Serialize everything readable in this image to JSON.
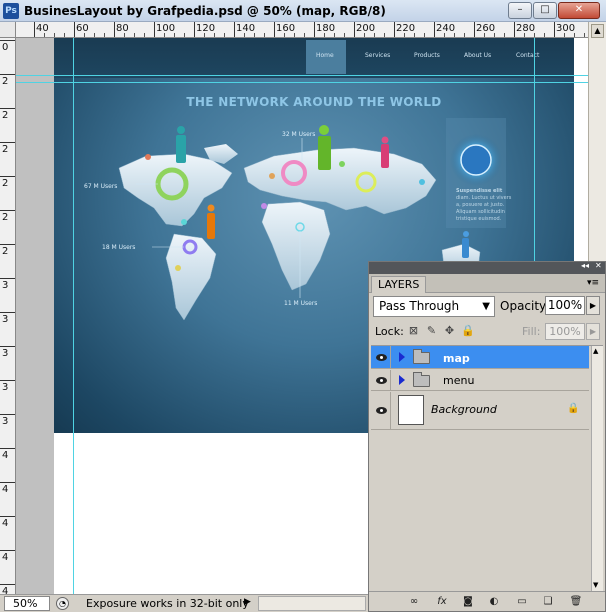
{
  "window": {
    "title": "BusinesLayout by Grafpedia.psd @ 50% (map, RGB/8)",
    "app_badge": "Ps",
    "minimize_glyph": "–",
    "maximize_glyph": "□",
    "close_glyph": "✕"
  },
  "rulers": {
    "horizontal_labels": [
      "40",
      "60",
      "80",
      "100",
      "120",
      "140",
      "160",
      "180",
      "200",
      "220",
      "240",
      "260",
      "280",
      "300"
    ],
    "vertical_labels": [
      "0",
      "2",
      "2",
      "2",
      "2",
      "2",
      "2",
      "3",
      "3",
      "3",
      "3",
      "3",
      "4",
      "4",
      "4",
      "4",
      "4"
    ]
  },
  "artwork": {
    "nav_items": [
      "Home",
      "Services",
      "Products",
      "About Us",
      "Contact"
    ],
    "headline": "THE NETWORK AROUND THE WORLD",
    "map_labels": [
      "32 M Users",
      "67 M Users",
      "18 M Users",
      "11 M Users"
    ],
    "side_text": [
      "Suspendisse elit",
      "diam. Luctus ut vivers",
      "a, posuere at justo.",
      "Aliquam sollicitudin",
      "tristique euismod."
    ]
  },
  "statusbar": {
    "zoom": "50%",
    "info_glyph": "◔",
    "status_text": "Exposure works in 32-bit only",
    "arrow": "▶"
  },
  "layers_panel": {
    "tab_label": "LAYERS",
    "collapse_glyph": "◂◂",
    "close_glyph": "✕",
    "menu_glyph": "▾≡",
    "blend_mode": "Pass Through",
    "blend_caret": "▼",
    "opacity_label": "Opacity:",
    "opacity_value": "100%",
    "spin_arrow": "▶",
    "lock_label": "Lock:",
    "lock_glyphs": [
      "⊠",
      "✎",
      "✥",
      "🔒"
    ],
    "fill_label": "Fill:",
    "fill_value": "100%",
    "layers": [
      {
        "name": "map",
        "type": "group",
        "selected": true,
        "visible": true
      },
      {
        "name": "menu",
        "type": "group",
        "selected": false,
        "visible": true
      },
      {
        "name": "Background",
        "type": "pixel",
        "selected": false,
        "visible": true,
        "locked": true
      }
    ],
    "background_lock_glyph": "🔒",
    "scroll_up": "▲",
    "scroll_down": "▼",
    "bottom_icons": [
      "∞",
      "fx",
      "◙",
      "◐",
      "▭",
      "❑",
      "🗑"
    ]
  },
  "colors": {
    "selection": "#3c8ef0",
    "guide": "#4fd3e3",
    "artwork_dark": "#1d4763",
    "headline": "#8ec6e6"
  }
}
